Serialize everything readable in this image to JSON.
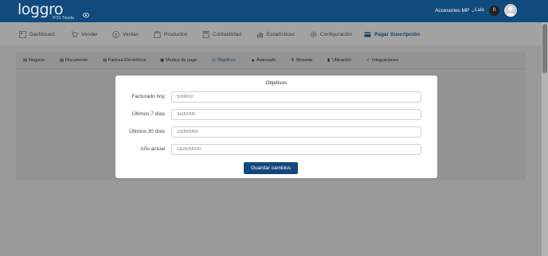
{
  "header": {
    "logo_text": "loggro",
    "logo_subtitle": "POS Tienda",
    "store_selector": "Accesorios MP ⌄",
    "user_name": "Luis",
    "notification_count": "0"
  },
  "nav": {
    "items": [
      {
        "label": "Dashboard",
        "icon": "dashboard-icon"
      },
      {
        "label": "Vender",
        "icon": "cart-icon"
      },
      {
        "label": "Ventas",
        "icon": "dollar-icon"
      },
      {
        "label": "Productos",
        "icon": "box-icon"
      },
      {
        "label": "Contabilidad",
        "icon": "calculator-icon"
      },
      {
        "label": "Estadísticas",
        "icon": "bar-chart-icon"
      },
      {
        "label": "Configuración",
        "icon": "gear-icon"
      },
      {
        "label": "Pagar Suscripción",
        "icon": "card-icon"
      }
    ]
  },
  "settings_tabs": [
    {
      "label": "Negocio",
      "icon": "store-icon"
    },
    {
      "label": "Documento",
      "icon": "document-icon"
    },
    {
      "label": "Factura Electrónica",
      "icon": "invoice-icon"
    },
    {
      "label": "Medios de pago",
      "icon": "wallet-icon"
    },
    {
      "label": "Objetivos",
      "icon": "target-icon"
    },
    {
      "label": "Avanzado",
      "icon": "rocket-icon"
    },
    {
      "label": "Moneda",
      "icon": "currency-icon"
    },
    {
      "label": "Ubicación",
      "icon": "location-icon"
    },
    {
      "label": "Integraciones",
      "icon": "check-icon"
    }
  ],
  "modal": {
    "title": "Objetivos",
    "fields": [
      {
        "label": "Facturado hoy",
        "value": "500000"
      },
      {
        "label": "Últimos 7 días",
        "value": "3500000"
      },
      {
        "label": "Últimos 30 días",
        "value": "15000000"
      },
      {
        "label": "Año actual",
        "value": "182500000"
      }
    ],
    "save_label": "Guardar cambios"
  },
  "colors": {
    "header_bg": "#114a7c",
    "accent": "#14477b",
    "overlay": "#9a9a9a"
  }
}
